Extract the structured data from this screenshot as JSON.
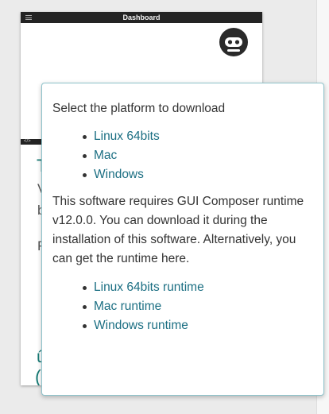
{
  "app": {
    "title": "Dashboard",
    "fragments": {
      "t": "T",
      "v": "V",
      "b": "b",
      "r": "F",
      "i1": "û",
      "i2": "("
    }
  },
  "popup": {
    "heading": "Select the platform to download",
    "platforms": [
      {
        "label": "Linux 64bits"
      },
      {
        "label": "Mac"
      },
      {
        "label": "Windows"
      }
    ],
    "note": "This software requires GUI Composer runtime v12.0.0. You can download it during the installation of this software. Alternatively, you can get the runtime here.",
    "runtimes": [
      {
        "label": "Linux 64bits runtime"
      },
      {
        "label": "Mac runtime"
      },
      {
        "label": "Windows runtime"
      }
    ]
  },
  "colors": {
    "link": "#1c6f83",
    "accent_teal": "#167a74",
    "titlebar": "#232323",
    "popup_border": "#8ec3cb"
  },
  "icons": {
    "menu": "menu-icon",
    "logo": "logo-icon"
  }
}
